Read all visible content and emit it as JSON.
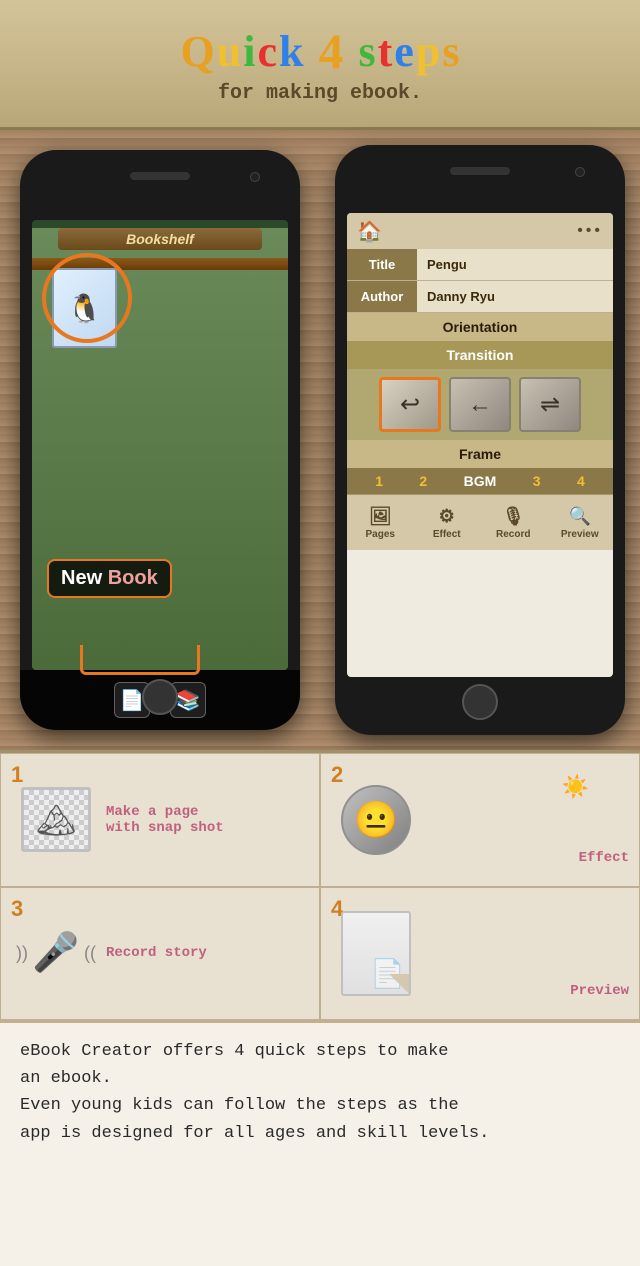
{
  "header": {
    "title_parts": [
      "Q",
      "u",
      "i",
      "c",
      "k",
      " ",
      "4",
      " ",
      "s",
      "t",
      "e",
      "p",
      "s"
    ],
    "title_display": "Quick 4 steps",
    "subtitle": "for making ebook."
  },
  "left_phone": {
    "bookshelf_label": "Bookshelf",
    "book_title": "Pengu",
    "new_book_badge": {
      "new": "New",
      "book": "Book"
    }
  },
  "right_phone": {
    "home_icon": "🏠",
    "dots": "•••",
    "fields": [
      {
        "label": "Title",
        "value": "Pengu"
      },
      {
        "label": "Author",
        "value": "Danny Ryu"
      }
    ],
    "orientation_label": "Orientation",
    "transition_label": "Transition",
    "frame_label": "Frame",
    "bgm_row": {
      "num1": "1",
      "num2": "2",
      "bgm": "BGM",
      "num3": "3",
      "num4": "4"
    },
    "tabs": [
      {
        "label": "Pages",
        "icon": "🖼"
      },
      {
        "label": "Effect",
        "icon": "⚙"
      },
      {
        "label": "Record",
        "icon": "🎙"
      },
      {
        "label": "Preview",
        "icon": "🔍"
      }
    ]
  },
  "steps": [
    {
      "num": "1",
      "label": "Make a page\nwith snap shot",
      "icon_type": "page-image"
    },
    {
      "num": "2",
      "label": "Effect",
      "icon_type": "face-sun"
    },
    {
      "num": "3",
      "label": "Record story",
      "icon_type": "mic"
    },
    {
      "num": "4",
      "label": "Preview",
      "icon_type": "book-flip"
    }
  ],
  "description": {
    "line1": "eBook Creator offers 4 quick steps to make",
    "line2": "an ebook.",
    "line3": "Even young kids can follow the steps as the",
    "line4": "app is designed for all ages and skill levels."
  },
  "colors": {
    "orange": "#e87820",
    "gold": "#f0c030",
    "pink": "#c06080",
    "brown": "#8a7848",
    "accent": "#e87820"
  }
}
